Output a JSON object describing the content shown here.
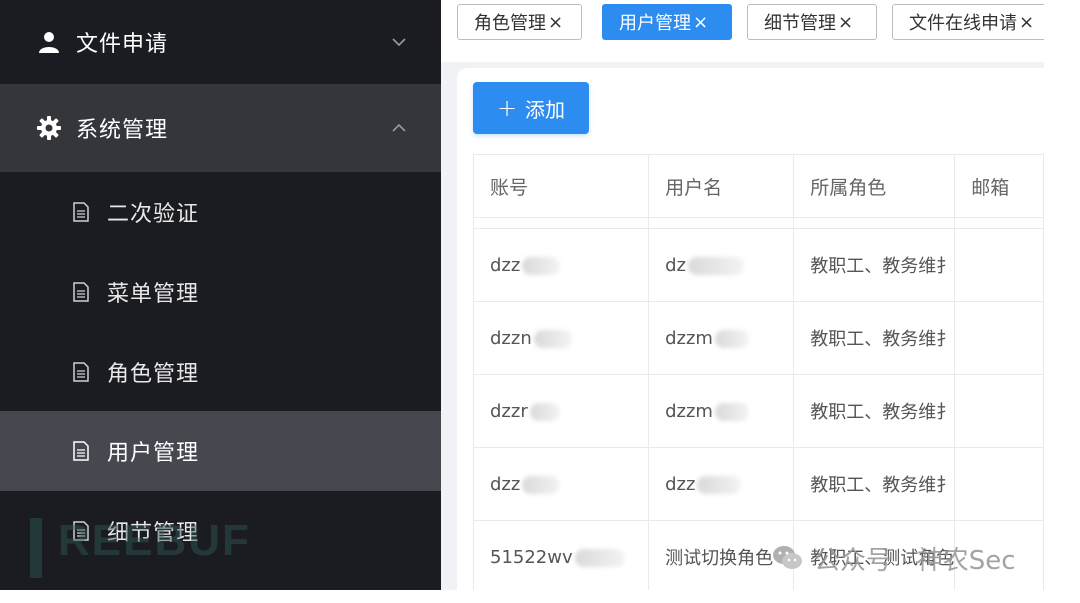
{
  "sidebar": {
    "top_item": {
      "label": "文件申请",
      "icon": "user-icon"
    },
    "group": {
      "label": "系统管理",
      "icon": "gear-icon"
    },
    "sub_items": [
      {
        "label": "二次验证",
        "icon": "document-icon"
      },
      {
        "label": "菜单管理",
        "icon": "document-icon"
      },
      {
        "label": "角色管理",
        "icon": "document-icon"
      },
      {
        "label": "用户管理",
        "icon": "document-icon",
        "active": true
      },
      {
        "label": "细节管理",
        "icon": "document-icon"
      }
    ],
    "watermark": "REEBUF"
  },
  "tabs": [
    {
      "label": "角色管理",
      "close": "×"
    },
    {
      "label": "用户管理",
      "close": "×",
      "active": true
    },
    {
      "label": "细节管理",
      "close": "×"
    },
    {
      "label": "文件在线申请",
      "close": "×"
    }
  ],
  "toolbar": {
    "add_label": "添加",
    "add_icon": "plus-icon"
  },
  "table": {
    "columns": [
      "账号",
      "用户名",
      "所属角色",
      "邮箱"
    ],
    "rows": [
      [
        "dzz",
        "dz",
        "教职工、教务维扌",
        ""
      ],
      [
        "dzzn",
        "dzzm",
        "教职工、教务维扌",
        ""
      ],
      [
        "dzzr",
        "dzzm",
        "教职工、教务维扌",
        ""
      ],
      [
        "dzz",
        "dzz",
        "教职工、教务维扌",
        ""
      ],
      [
        "51522wv",
        "测试切换角色",
        "教职工、测试角色",
        ""
      ]
    ]
  },
  "watermark": {
    "text": "公众号 · 神农Sec",
    "icon": "wechat-icon"
  },
  "colors": {
    "sidebar_bg": "#1b1c22",
    "sidebar_active": "#464850",
    "primary": "#2d8cf0"
  }
}
